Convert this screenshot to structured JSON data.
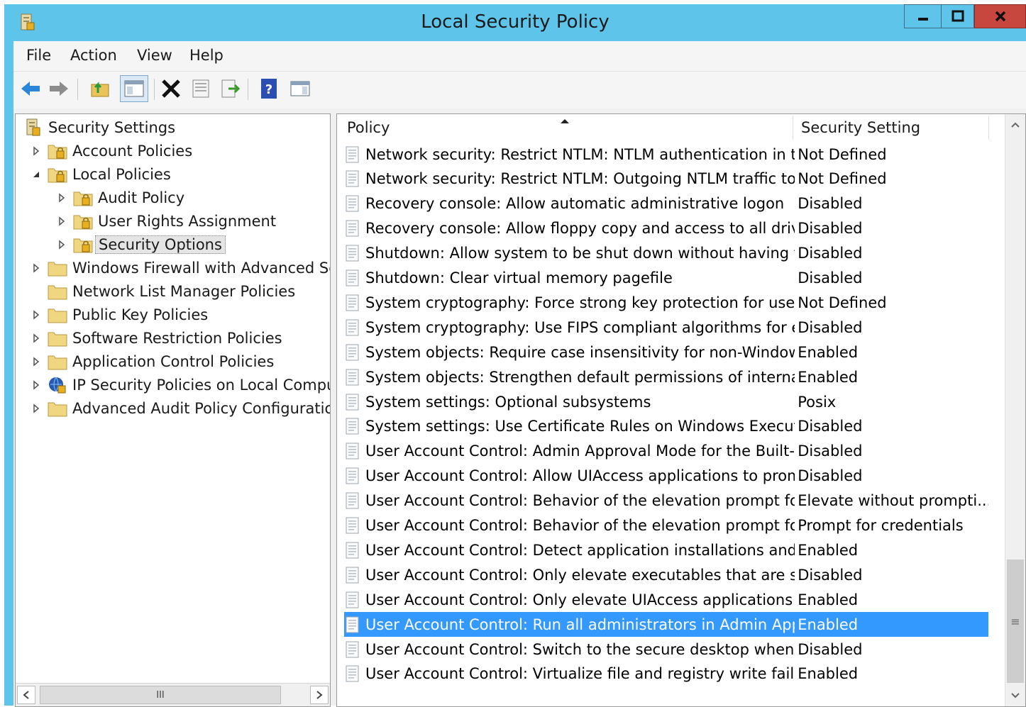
{
  "window": {
    "title": "Local Security Policy"
  },
  "menu": [
    "File",
    "Action",
    "View",
    "Help"
  ],
  "toolbar": {
    "buttons": [
      "back-icon",
      "forward-icon",
      "up-folder-icon",
      "show-hide-tree-icon",
      "delete-icon",
      "properties-icon",
      "export-list-icon",
      "help-icon",
      "console-icon"
    ]
  },
  "tree": {
    "items": [
      {
        "label": "Security Settings",
        "level": 0,
        "expander": "none",
        "icon": "security-settings-icon"
      },
      {
        "label": "Account Policies",
        "level": 1,
        "expander": "collapsed",
        "icon": "policy-folder-icon"
      },
      {
        "label": "Local Policies",
        "level": 1,
        "expander": "expanded",
        "icon": "policy-folder-icon"
      },
      {
        "label": "Audit Policy",
        "level": 2,
        "expander": "collapsed",
        "icon": "policy-folder-icon"
      },
      {
        "label": "User Rights Assignment",
        "level": 2,
        "expander": "collapsed",
        "icon": "policy-folder-icon"
      },
      {
        "label": "Security Options",
        "level": 2,
        "expander": "collapsed",
        "icon": "policy-folder-icon",
        "selected": true
      },
      {
        "label": "Windows Firewall with Advanced Sec",
        "level": 1,
        "expander": "collapsed",
        "icon": "folder-icon"
      },
      {
        "label": "Network List Manager Policies",
        "level": 1,
        "expander": "none",
        "icon": "folder-icon"
      },
      {
        "label": "Public Key Policies",
        "level": 1,
        "expander": "collapsed",
        "icon": "folder-icon"
      },
      {
        "label": "Software Restriction Policies",
        "level": 1,
        "expander": "collapsed",
        "icon": "folder-icon"
      },
      {
        "label": "Application Control Policies",
        "level": 1,
        "expander": "collapsed",
        "icon": "folder-icon"
      },
      {
        "label": "IP Security Policies on Local Compute",
        "level": 1,
        "expander": "collapsed",
        "icon": "ip-security-icon"
      },
      {
        "label": "Advanced Audit Policy Configuration",
        "level": 1,
        "expander": "collapsed",
        "icon": "folder-icon"
      }
    ]
  },
  "list": {
    "columns": {
      "policy": "Policy",
      "setting": "Security Setting"
    },
    "rows": [
      {
        "policy": "Network security: Restrict NTLM: NTLM authentication in th...",
        "setting": "Not Defined"
      },
      {
        "policy": "Network security: Restrict NTLM: Outgoing NTLM traffic to ...",
        "setting": "Not Defined"
      },
      {
        "policy": "Recovery console: Allow automatic administrative logon",
        "setting": "Disabled"
      },
      {
        "policy": "Recovery console: Allow floppy copy and access to all drives...",
        "setting": "Disabled"
      },
      {
        "policy": "Shutdown: Allow system to be shut down without having to...",
        "setting": "Disabled"
      },
      {
        "policy": "Shutdown: Clear virtual memory pagefile",
        "setting": "Disabled"
      },
      {
        "policy": "System cryptography: Force strong key protection for user k...",
        "setting": "Not Defined"
      },
      {
        "policy": "System cryptography: Use FIPS compliant algorithms for en...",
        "setting": "Disabled"
      },
      {
        "policy": "System objects: Require case insensitivity for non-Windows ...",
        "setting": "Enabled"
      },
      {
        "policy": "System objects: Strengthen default permissions of internal s...",
        "setting": "Enabled"
      },
      {
        "policy": "System settings: Optional subsystems",
        "setting": "Posix"
      },
      {
        "policy": "System settings: Use Certificate Rules on Windows Executabl...",
        "setting": "Disabled"
      },
      {
        "policy": "User Account Control: Admin Approval Mode for the Built-i...",
        "setting": "Disabled"
      },
      {
        "policy": "User Account Control: Allow UIAccess applications to prom...",
        "setting": "Disabled"
      },
      {
        "policy": "User Account Control: Behavior of the elevation prompt for ...",
        "setting": "Elevate without prompti..."
      },
      {
        "policy": "User Account Control: Behavior of the elevation prompt for ...",
        "setting": "Prompt for credentials"
      },
      {
        "policy": "User Account Control: Detect application installations and p...",
        "setting": "Enabled"
      },
      {
        "policy": "User Account Control: Only elevate executables that are sign...",
        "setting": "Disabled"
      },
      {
        "policy": "User Account Control: Only elevate UIAccess applications th...",
        "setting": "Enabled"
      },
      {
        "policy": "User Account Control: Run all administrators in Admin Appr...",
        "setting": "Enabled",
        "selected": true
      },
      {
        "policy": "User Account Control: Switch to the secure desktop when pr...",
        "setting": "Disabled"
      },
      {
        "policy": "User Account Control: Virtualize file and registry write failure...",
        "setting": "Enabled"
      }
    ]
  },
  "scrollbar": {
    "hscroll_thumb_glyph": "III",
    "vscroll_grip_glyph": "≡"
  },
  "colors": {
    "titlebar": "#5ec4e9",
    "close": "#c7463d",
    "selection": "#3399ff"
  }
}
